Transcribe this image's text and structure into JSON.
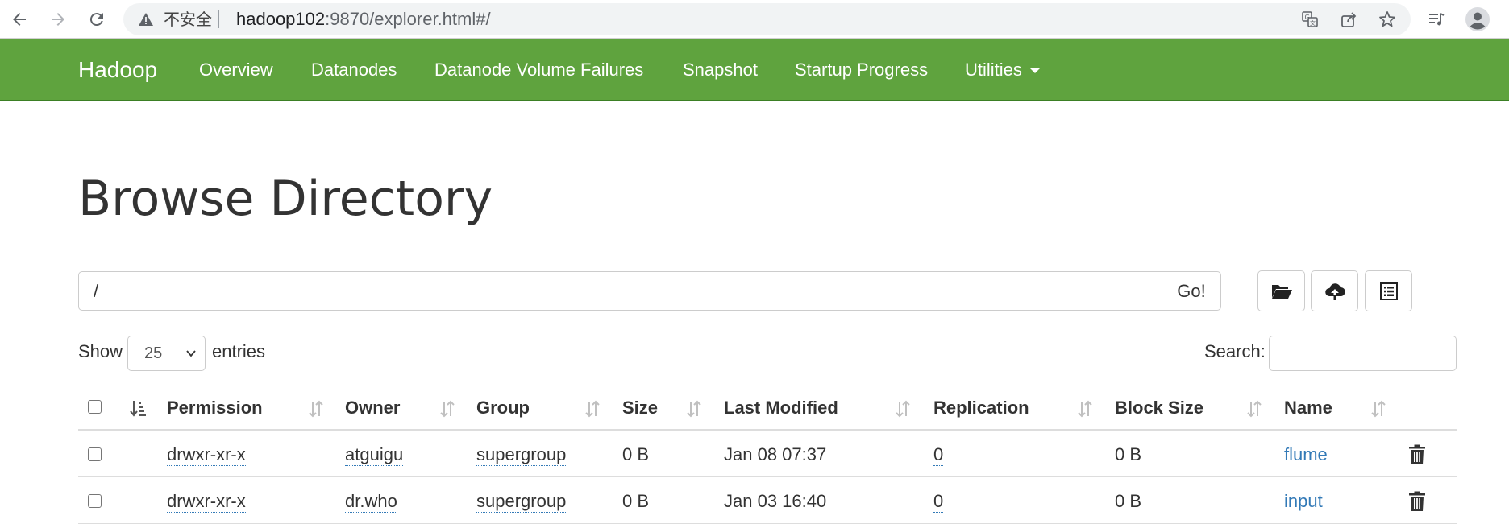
{
  "browser": {
    "insecure_label": "不安全",
    "url_host": "hadoop102",
    "url_rest": ":9870/explorer.html#/"
  },
  "navbar": {
    "brand": "Hadoop",
    "items": [
      "Overview",
      "Datanodes",
      "Datanode Volume Failures",
      "Snapshot",
      "Startup Progress",
      "Utilities"
    ],
    "bg_color": "#5fa33e"
  },
  "page": {
    "title": "Browse Directory",
    "path_value": "/",
    "go_label": "Go!",
    "show_label": "Show",
    "entries_value": "25",
    "entries_label": "entries",
    "search_label": "Search:",
    "search_value": ""
  },
  "table": {
    "columns": [
      "Permission",
      "Owner",
      "Group",
      "Size",
      "Last Modified",
      "Replication",
      "Block Size",
      "Name"
    ],
    "rows": [
      {
        "permission": "drwxr-xr-x",
        "owner": "atguigu",
        "group": "supergroup",
        "size": "0 B",
        "modified": "Jan 08 07:37",
        "replication": "0",
        "block_size": "0 B",
        "name": "flume"
      },
      {
        "permission": "drwxr-xr-x",
        "owner": "dr.who",
        "group": "supergroup",
        "size": "0 B",
        "modified": "Jan 03 16:40",
        "replication": "0",
        "block_size": "0 B",
        "name": "input"
      }
    ]
  },
  "icons": [
    "back-icon",
    "forward-icon",
    "reload-icon",
    "warning-icon",
    "translate-icon",
    "share-icon",
    "bookmark-star-icon",
    "reading-list-icon",
    "profile-icon",
    "folder-open-icon",
    "cloud-upload-icon",
    "list-alt-icon",
    "trash-icon",
    "sort-icon"
  ]
}
